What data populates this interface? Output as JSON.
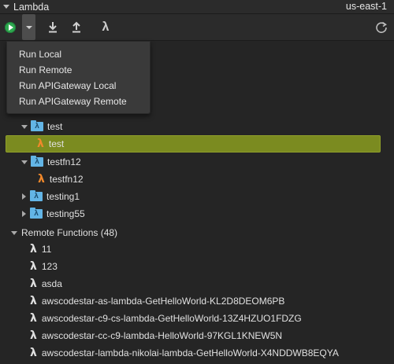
{
  "header": {
    "title": "Lambda",
    "region": "us-east-1"
  },
  "toolbar": {
    "run_icon": "play-circle-icon",
    "dropdown_icon": "chevron-down-icon",
    "download_icon": "download-icon",
    "upload_icon": "upload-icon",
    "lambda_icon": "λ",
    "refresh_icon": "refresh-icon",
    "run_color": "#2ea84f"
  },
  "run_menu": {
    "items": [
      {
        "label": "Run Local"
      },
      {
        "label": "Run Remote"
      },
      {
        "label": "Run APIGateway Local"
      },
      {
        "label": "Run APIGateway Remote"
      }
    ]
  },
  "tree": {
    "local": [
      {
        "name": "test",
        "expanded": true,
        "children": [
          {
            "name": "test",
            "selected": true
          }
        ]
      },
      {
        "name": "testfn12",
        "expanded": true,
        "children": [
          {
            "name": "testfn12"
          }
        ]
      },
      {
        "name": "testing1",
        "expanded": false
      },
      {
        "name": "testing55",
        "expanded": false
      }
    ],
    "remote": {
      "label": "Remote Functions (48)",
      "items": [
        {
          "name": "11"
        },
        {
          "name": "123"
        },
        {
          "name": "asda"
        },
        {
          "name": "awscodestar-as-lambda-GetHelloWorld-KL2D8DEOM6PB"
        },
        {
          "name": "awscodestar-c9-cs-lambda-GetHelloWorld-13Z4HZUO1FDZG"
        },
        {
          "name": "awscodestar-cc-c9-lambda-HelloWorld-97KGL1KNEW5N"
        },
        {
          "name": "awscodestar-lambda-nikolai-lambda-GetHelloWorld-X4NDDWB8EQYA"
        }
      ]
    },
    "lambda_symbol": "λ",
    "selected_color": "#7b8b20",
    "lambda_local_color": "#f0882b",
    "folder_color": "#63b5e6"
  }
}
